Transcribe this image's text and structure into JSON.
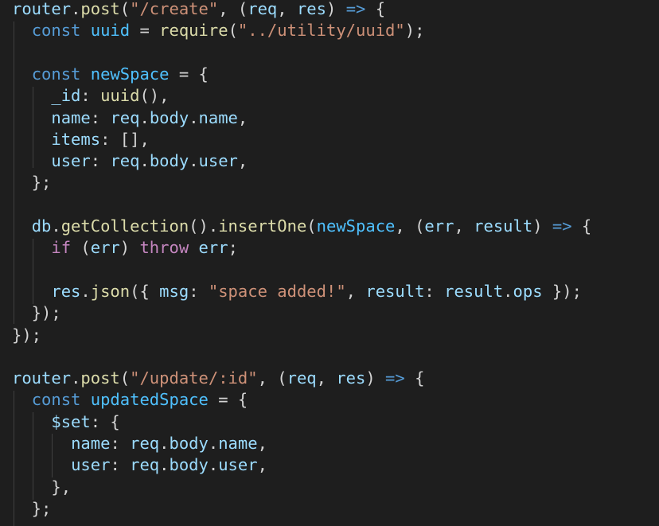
{
  "colors": {
    "background": "#1e1e1e",
    "keyword": "#569cd6",
    "control": "#c586c0",
    "function": "#dcdcaa",
    "string": "#ce9178",
    "variable": "#9cdcfe",
    "constant": "#4fc1ff",
    "punctuation": "#d4d4d4",
    "indent_guide": "#404040"
  },
  "code": {
    "lines": [
      [
        [
          "var",
          "router"
        ],
        [
          "pun",
          "."
        ],
        [
          "fn",
          "post"
        ],
        [
          "pun",
          "("
        ],
        [
          "str",
          "\"/create\""
        ],
        [
          "pun",
          ", ("
        ],
        [
          "var",
          "req"
        ],
        [
          "pun",
          ", "
        ],
        [
          "var",
          "res"
        ],
        [
          "pun",
          ") "
        ],
        [
          "kw",
          "=>"
        ],
        [
          "pun",
          " {"
        ]
      ],
      [
        [
          "pun",
          "  "
        ],
        [
          "kw",
          "const"
        ],
        [
          "pun",
          " "
        ],
        [
          "cst",
          "uuid"
        ],
        [
          "pun",
          " = "
        ],
        [
          "fn",
          "require"
        ],
        [
          "pun",
          "("
        ],
        [
          "str",
          "\"../utility/uuid\""
        ],
        [
          "pun",
          ");"
        ]
      ],
      [],
      [
        [
          "pun",
          "  "
        ],
        [
          "kw",
          "const"
        ],
        [
          "pun",
          " "
        ],
        [
          "cst",
          "newSpace"
        ],
        [
          "pun",
          " = {"
        ]
      ],
      [
        [
          "pun",
          "    "
        ],
        [
          "var",
          "_id"
        ],
        [
          "pun",
          ": "
        ],
        [
          "fn",
          "uuid"
        ],
        [
          "pun",
          "(),"
        ]
      ],
      [
        [
          "pun",
          "    "
        ],
        [
          "var",
          "name"
        ],
        [
          "pun",
          ": "
        ],
        [
          "var",
          "req"
        ],
        [
          "pun",
          "."
        ],
        [
          "var",
          "body"
        ],
        [
          "pun",
          "."
        ],
        [
          "var",
          "name"
        ],
        [
          "pun",
          ","
        ]
      ],
      [
        [
          "pun",
          "    "
        ],
        [
          "var",
          "items"
        ],
        [
          "pun",
          ": [],"
        ]
      ],
      [
        [
          "pun",
          "    "
        ],
        [
          "var",
          "user"
        ],
        [
          "pun",
          ": "
        ],
        [
          "var",
          "req"
        ],
        [
          "pun",
          "."
        ],
        [
          "var",
          "body"
        ],
        [
          "pun",
          "."
        ],
        [
          "var",
          "user"
        ],
        [
          "pun",
          ","
        ]
      ],
      [
        [
          "pun",
          "  };"
        ]
      ],
      [],
      [
        [
          "pun",
          "  "
        ],
        [
          "var",
          "db"
        ],
        [
          "pun",
          "."
        ],
        [
          "fn",
          "getCollection"
        ],
        [
          "pun",
          "()."
        ],
        [
          "fn",
          "insertOne"
        ],
        [
          "pun",
          "("
        ],
        [
          "cst",
          "newSpace"
        ],
        [
          "pun",
          ", ("
        ],
        [
          "var",
          "err"
        ],
        [
          "pun",
          ", "
        ],
        [
          "var",
          "result"
        ],
        [
          "pun",
          ") "
        ],
        [
          "kw",
          "=>"
        ],
        [
          "pun",
          " {"
        ]
      ],
      [
        [
          "pun",
          "    "
        ],
        [
          "ctl",
          "if"
        ],
        [
          "pun",
          " ("
        ],
        [
          "var",
          "err"
        ],
        [
          "pun",
          ") "
        ],
        [
          "ctl",
          "throw"
        ],
        [
          "pun",
          " "
        ],
        [
          "var",
          "err"
        ],
        [
          "pun",
          ";"
        ]
      ],
      [],
      [
        [
          "pun",
          "    "
        ],
        [
          "var",
          "res"
        ],
        [
          "pun",
          "."
        ],
        [
          "fn",
          "json"
        ],
        [
          "pun",
          "({ "
        ],
        [
          "var",
          "msg"
        ],
        [
          "pun",
          ": "
        ],
        [
          "str",
          "\"space added!\""
        ],
        [
          "pun",
          ", "
        ],
        [
          "var",
          "result"
        ],
        [
          "pun",
          ": "
        ],
        [
          "var",
          "result"
        ],
        [
          "pun",
          "."
        ],
        [
          "var",
          "ops"
        ],
        [
          "pun",
          " });"
        ]
      ],
      [
        [
          "pun",
          "  });"
        ]
      ],
      [
        [
          "pun",
          "});"
        ]
      ],
      [],
      [
        [
          "var",
          "router"
        ],
        [
          "pun",
          "."
        ],
        [
          "fn",
          "post"
        ],
        [
          "pun",
          "("
        ],
        [
          "str",
          "\"/update/:id\""
        ],
        [
          "pun",
          ", ("
        ],
        [
          "var",
          "req"
        ],
        [
          "pun",
          ", "
        ],
        [
          "var",
          "res"
        ],
        [
          "pun",
          ") "
        ],
        [
          "kw",
          "=>"
        ],
        [
          "pun",
          " {"
        ]
      ],
      [
        [
          "pun",
          "  "
        ],
        [
          "kw",
          "const"
        ],
        [
          "pun",
          " "
        ],
        [
          "cst",
          "updatedSpace"
        ],
        [
          "pun",
          " = {"
        ]
      ],
      [
        [
          "pun",
          "    "
        ],
        [
          "var",
          "$set"
        ],
        [
          "pun",
          ": {"
        ]
      ],
      [
        [
          "pun",
          "      "
        ],
        [
          "var",
          "name"
        ],
        [
          "pun",
          ": "
        ],
        [
          "var",
          "req"
        ],
        [
          "pun",
          "."
        ],
        [
          "var",
          "body"
        ],
        [
          "pun",
          "."
        ],
        [
          "var",
          "name"
        ],
        [
          "pun",
          ","
        ]
      ],
      [
        [
          "pun",
          "      "
        ],
        [
          "var",
          "user"
        ],
        [
          "pun",
          ": "
        ],
        [
          "var",
          "req"
        ],
        [
          "pun",
          "."
        ],
        [
          "var",
          "body"
        ],
        [
          "pun",
          "."
        ],
        [
          "var",
          "user"
        ],
        [
          "pun",
          ","
        ]
      ],
      [
        [
          "pun",
          "    },"
        ]
      ],
      [
        [
          "pun",
          "  };"
        ]
      ]
    ]
  }
}
